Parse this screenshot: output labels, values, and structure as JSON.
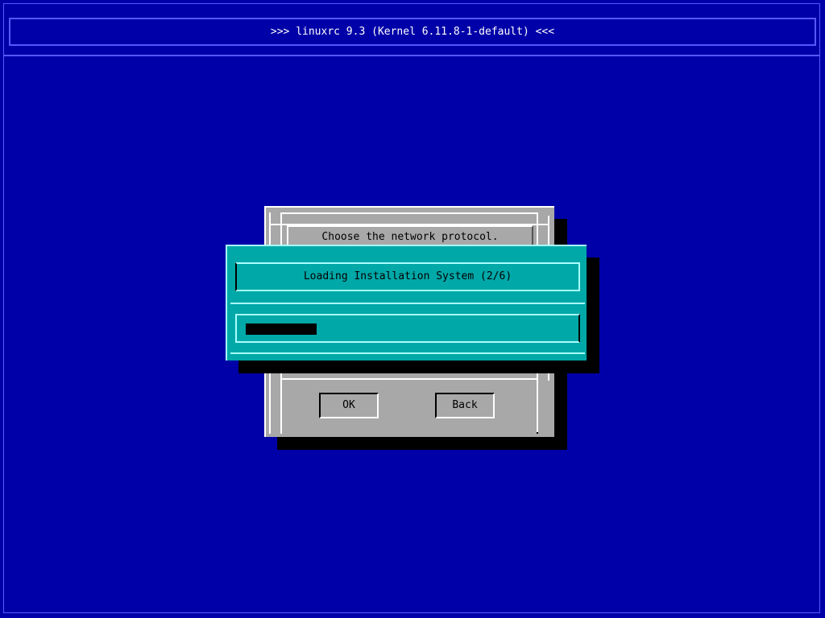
{
  "title_bar": {
    "text": ">>> linuxrc 9.3 (Kernel 6.11.8-1-default) <<<"
  },
  "background_dialog": {
    "prompt": "Choose the network protocol.",
    "ok_label": "OK",
    "back_label": "Back"
  },
  "loading_dialog": {
    "title": "Loading Installation System (2/6)",
    "progress_fraction": 0.22
  },
  "colors": {
    "screen_background": "#0000a8",
    "dialog_grey": "#a8a8a8",
    "dialog_cyan": "#00a8a8",
    "progress_fill": "#000000"
  }
}
